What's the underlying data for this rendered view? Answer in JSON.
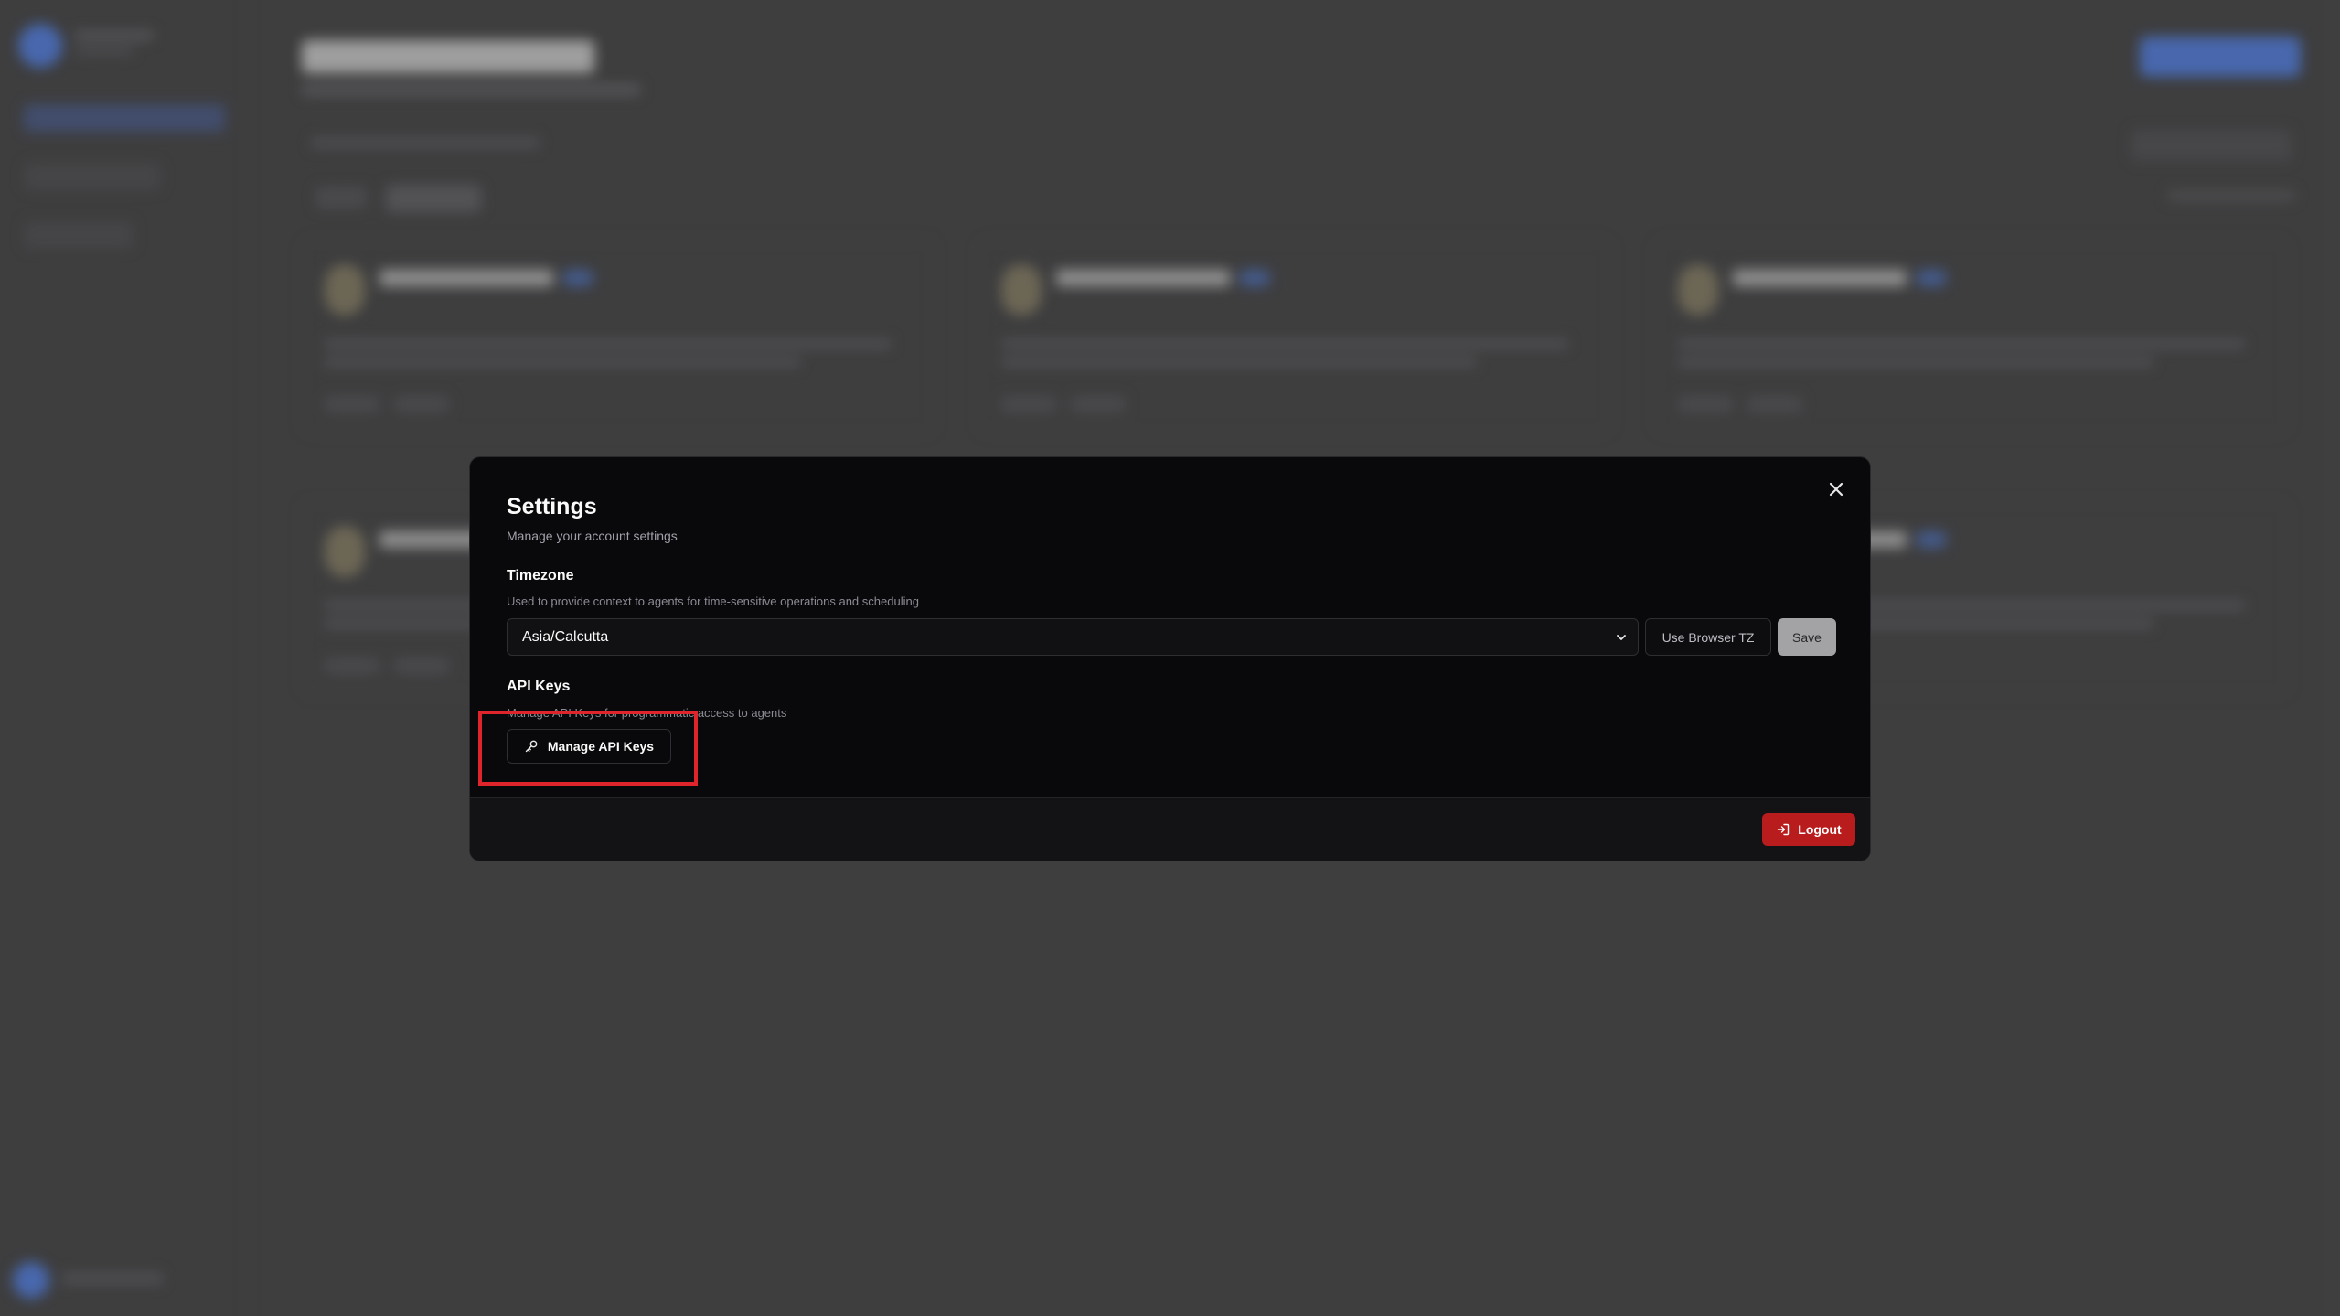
{
  "modal": {
    "title": "Settings",
    "subtitle": "Manage your account settings",
    "timezone": {
      "title": "Timezone",
      "description": "Used to provide context to agents for time-sensitive operations and scheduling",
      "selected": "Asia/Calcutta",
      "use_browser_label": "Use Browser TZ",
      "save_label": "Save"
    },
    "api_keys": {
      "title": "API Keys",
      "description": "Manage API Keys for programmatic access to agents",
      "manage_label": "Manage API Keys"
    },
    "footer": {
      "logout_label": "Logout"
    }
  },
  "icons": {
    "close": "close-icon",
    "chevron": "chevron-down-icon",
    "key": "key-icon",
    "logout": "logout-icon"
  },
  "colors": {
    "accent_blue": "#1f5be0",
    "danger": "#b91c1c",
    "highlight": "#e0242b"
  }
}
